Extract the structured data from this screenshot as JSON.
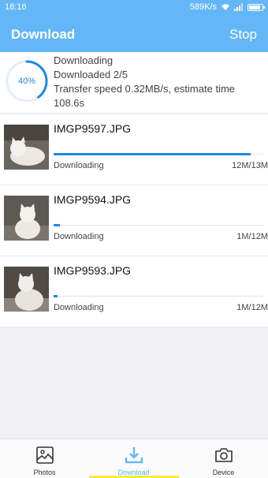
{
  "status": {
    "time": "18:16",
    "net_speed": "589K/s"
  },
  "header": {
    "title": "Download",
    "stop_label": "Stop"
  },
  "summary": {
    "percent_label": "40%",
    "progress": 0.4,
    "state": "Downloading",
    "count_text": "Downloaded 2/5",
    "speed_text": "Transfer speed 0.32MB/s, estimate time",
    "time_text": "108.6s"
  },
  "items": [
    {
      "name": "IMGP9597.JPG",
      "status": "Downloading",
      "size": "12M/13M",
      "progress": 0.94
    },
    {
      "name": "IMGP9594.JPG",
      "status": "Downloading",
      "size": "1M/12M",
      "progress": 0.03
    },
    {
      "name": "IMGP9593.JPG",
      "status": "Downloading",
      "size": "1M/12M",
      "progress": 0.01
    }
  ],
  "nav": [
    {
      "label": "Photos",
      "icon": "photos-icon"
    },
    {
      "label": "Download",
      "icon": "download-icon",
      "active": true
    },
    {
      "label": "Device",
      "icon": "camera-icon"
    }
  ],
  "colors": {
    "accent": "#64b7f6",
    "progress": "#1e88e5",
    "indicator": "#f8eb3a"
  }
}
